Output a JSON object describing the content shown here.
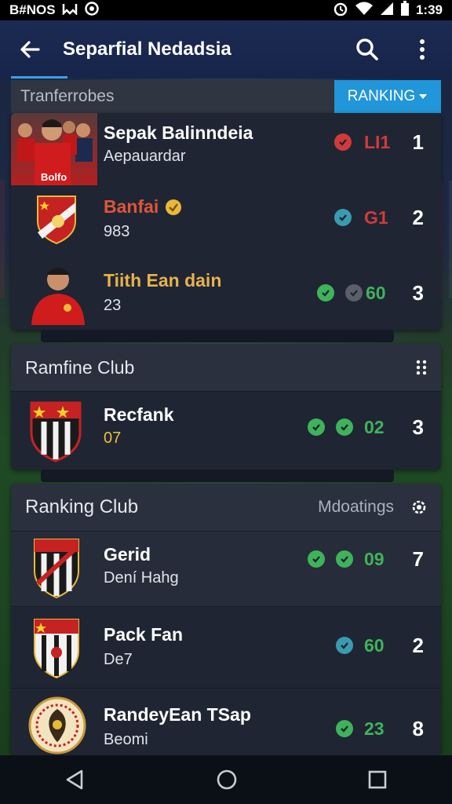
{
  "status_bar": {
    "left_text": "B#NOS",
    "time": "1:39"
  },
  "app_bar": {
    "title": "Separfial Nedadsia"
  },
  "tabs": {
    "left": "Tranferrobes",
    "right": "RANKING"
  },
  "card1": {
    "rows": [
      {
        "name": "Sepak Balinndeia",
        "sub": "Aepauardar",
        "score": "LI1",
        "rank": "1",
        "score_color": "#d23a3a"
      },
      {
        "name": "Banfai",
        "sub": "983",
        "score": "G1",
        "rank": "2",
        "score_color": "#d23a3a",
        "name_color": "#e0553a"
      },
      {
        "name": "Tiith Ean dain",
        "sub": "23",
        "score": "60",
        "rank": "3",
        "score_color": "#3fb35a",
        "name_color": "#e8b34a"
      }
    ],
    "photo_caption": "Bolfo"
  },
  "card2": {
    "header": "Ramfine Club",
    "rows": [
      {
        "name": "Recfank",
        "sub": "07",
        "score": "02",
        "rank": "3",
        "score_color": "#3fb35a",
        "sub_color": "#e8c23a"
      }
    ]
  },
  "card3": {
    "header": "Ranking Club",
    "header_right": "Mdoatings",
    "rows": [
      {
        "name": "Gerid",
        "sub": "Dení Hahg",
        "score": "09",
        "rank": "7",
        "score_color": "#3fb35a"
      },
      {
        "name": "Pack Fan",
        "sub": "De7",
        "score": "60",
        "rank": "2",
        "score_color": "#3fb35a"
      },
      {
        "name": "RandeyEan TSap",
        "sub": "Beomi",
        "score": "23",
        "rank": "8",
        "score_color": "#3fb35a"
      }
    ]
  },
  "colors": {
    "accent": "#2196d9",
    "card": "#1f2533",
    "green_check": "#3fb35a",
    "red_check": "#d23a3a",
    "teal_check": "#3a9bb0",
    "grey_check": "#5a5f6a"
  }
}
